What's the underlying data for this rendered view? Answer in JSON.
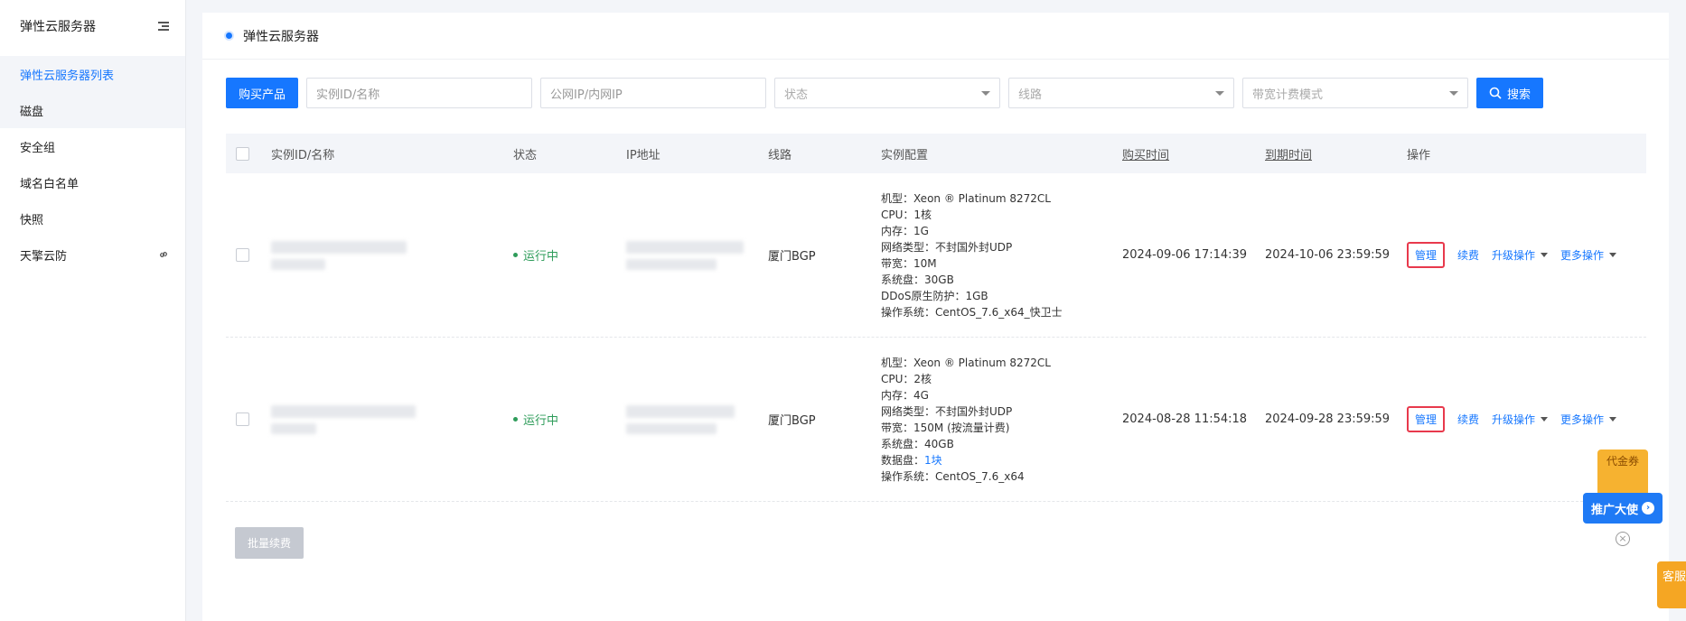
{
  "sidebar": {
    "title": "弹性云服务器",
    "items": [
      {
        "label": "弹性云服务器列表"
      },
      {
        "label": "磁盘"
      },
      {
        "label": "安全组"
      },
      {
        "label": "域名白名单"
      },
      {
        "label": "快照"
      },
      {
        "label": "天擎云防"
      }
    ]
  },
  "main": {
    "title": "弹性云服务器"
  },
  "toolbar": {
    "buy_label": "购买产品",
    "id_placeholder": "实例ID/名称",
    "ip_placeholder": "公网IP/内网IP",
    "status_placeholder": "状态",
    "line_placeholder": "线路",
    "billing_placeholder": "带宽计费模式",
    "search_label": "搜索"
  },
  "table": {
    "headers": {
      "id": "实例ID/名称",
      "status": "状态",
      "ip": "IP地址",
      "line": "线路",
      "config": "实例配置",
      "buy_time": "购买时间",
      "expire_time": "到期时间",
      "ops": "操作"
    },
    "rows": [
      {
        "status": "运行中",
        "line": "厦门BGP",
        "config": [
          "机型：Xeon ® Platinum 8272CL",
          "CPU：1核",
          "内存：1G",
          "网络类型：不封国外封UDP",
          "带宽：10M",
          "系统盘：30GB",
          "DDoS原生防护：1GB",
          "操作系统：CentOS_7.6_x64_快卫士"
        ],
        "buy_time": "2024-09-06 17:14:39",
        "expire_time": "2024-10-06 23:59:59"
      },
      {
        "status": "运行中",
        "line": "厦门BGP",
        "config": [
          "机型：Xeon ® Platinum 8272CL",
          "CPU：2核",
          "内存：4G",
          "网络类型：不封国外封UDP",
          "带宽：150M (按流量计费)",
          "系统盘：40GB"
        ],
        "config_disk_label": "数据盘：",
        "config_disk_value": "1块",
        "config_os": "操作系统：CentOS_7.6_x64",
        "buy_time": "2024-08-28 11:54:18",
        "expire_time": "2024-09-28 23:59:59"
      }
    ],
    "ops": {
      "manage": "管理",
      "renew": "续费",
      "upgrade": "升级操作",
      "more": "更多操作"
    }
  },
  "batch_renew": "批量续费",
  "promo": {
    "coupon": "代金券",
    "label": "推广大使"
  },
  "service": "客服"
}
